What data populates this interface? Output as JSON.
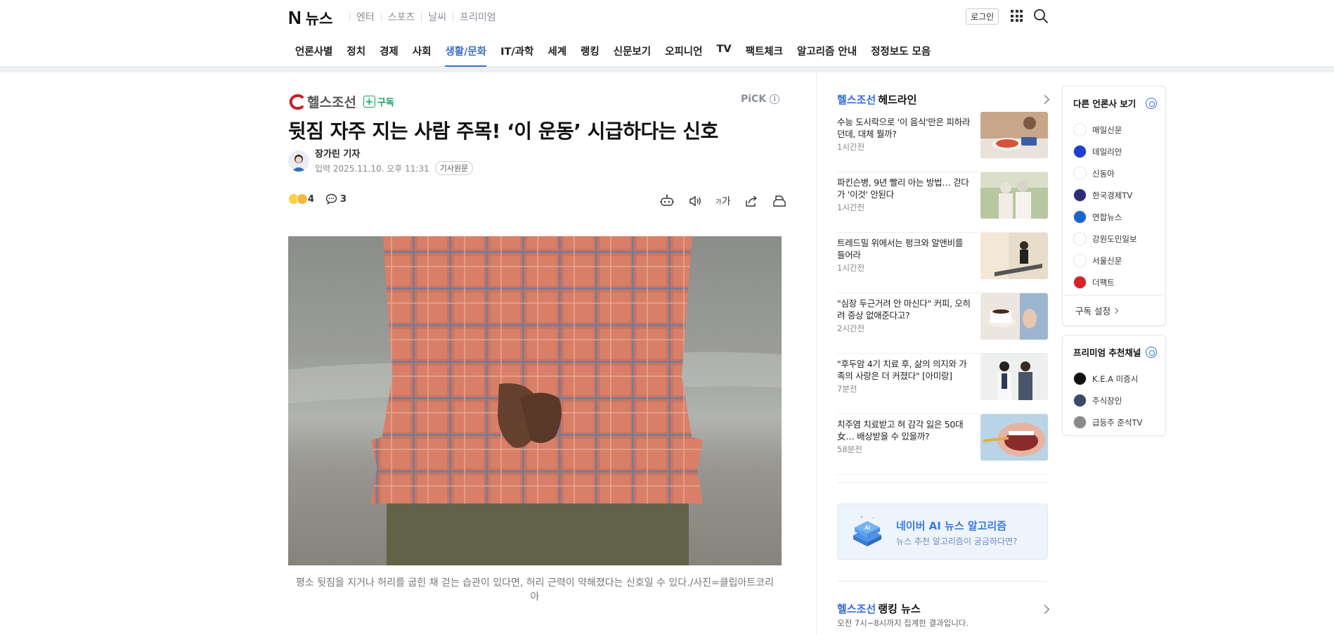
{
  "header": {
    "logo_n": "N",
    "logo_news": "뉴스",
    "service_links": [
      "엔터",
      "스포츠",
      "날씨",
      "프리미엄"
    ],
    "login_label": "로그인",
    "nav": [
      {
        "label": "언론사별"
      },
      {
        "label": "정치"
      },
      {
        "label": "경제"
      },
      {
        "label": "사회"
      },
      {
        "label": "생활/문화",
        "active": true
      },
      {
        "label": "IT/과학"
      },
      {
        "label": "세계"
      },
      {
        "label": "랭킹"
      },
      {
        "label": "신문보기"
      },
      {
        "label": "오피니언"
      },
      {
        "label": "TV"
      },
      {
        "label": "팩트체크"
      },
      {
        "label": "알고리즘 안내"
      },
      {
        "label": "정정보도 모음"
      }
    ]
  },
  "article": {
    "press_name": "헬스조선",
    "subscribe_label": "구독",
    "pick_label": "PiCK",
    "pick_info": "i",
    "title": "뒷짐 자주 지는 사람 주목! ‘이 운동’ 시급하다는 신호",
    "reporter": "장가린 기자",
    "date": "입력 2025.11.10. 오후 11:31",
    "original_button": "기사원문",
    "reaction_count": "4",
    "comment_count": "3",
    "font_tool_label": "가",
    "caption": "평소 뒷짐을 지거나 허리를 굽힌 채 걷는 습관이 있다면, 허리 근력이 약해졌다는 신호일 수 있다./사진=클립아트코리아"
  },
  "headlines": {
    "brand": "헬스조선",
    "title": "헤드라인",
    "items": [
      {
        "title": "수능 도시락으로 '이 음식'만은 피하라던데, 대체 뭘까?",
        "time": "1시간전"
      },
      {
        "title": "파킨슨병, 9년 빨리 아는 방법… 걷다가 '이것' 안된다",
        "time": "1시간전"
      },
      {
        "title": "트레드밀 위에서는 펑크와 알앤비를 들어라",
        "time": "1시간전"
      },
      {
        "title": "\"심장 두근거려 안 마신다\" 커피, 오히려 증상 없애준다고?",
        "time": "2시간전"
      },
      {
        "title": "\"후두암 4기 치료 후, 삶의 의지와 가족의 사랑은 더 커졌다\" [아미랑]",
        "time": "7분전"
      },
      {
        "title": "치주염 치료받고 혀 감각 잃은 50대 女… 배상받을 수 있을까?",
        "time": "58분전"
      }
    ]
  },
  "ai_banner": {
    "title": "네이버 AI 뉴스 알고리즘",
    "subtitle": "뉴스 추천 알고리즘이 궁금하다면?",
    "icon_text": "AI"
  },
  "ranking": {
    "brand": "헬스조선",
    "title": "랭킹 뉴스",
    "subtitle": "오전 7시~8시까지 집계한 결과입니다."
  },
  "side_press": {
    "title": "다른 언론사 보기",
    "items": [
      {
        "name": "매일신문",
        "color": "#ffffff"
      },
      {
        "name": "데일리안",
        "color": "#1f3fd1"
      },
      {
        "name": "신동아",
        "color": "#ffffff"
      },
      {
        "name": "한국경제TV",
        "color": "#2b2e7a"
      },
      {
        "name": "연합뉴스",
        "color": "#1a67c9"
      },
      {
        "name": "강원도민일보",
        "color": "#ffffff"
      },
      {
        "name": "서울신문",
        "color": "#ffffff"
      },
      {
        "name": "더팩트",
        "color": "#d8222a"
      }
    ],
    "footer": "구독 설정"
  },
  "side_premium": {
    "title": "프리미엄 추천채널",
    "items": [
      {
        "name": "K.E.A 미증시",
        "color": "#111111"
      },
      {
        "name": "주식장인",
        "color": "#3b4a6b"
      },
      {
        "name": "급등주 준석TV",
        "color": "#8a8a8a"
      }
    ]
  }
}
